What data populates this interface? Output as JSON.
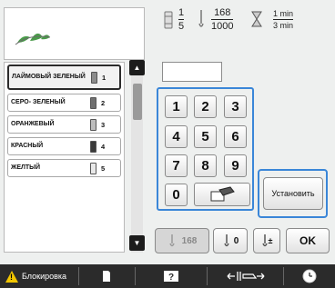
{
  "stats": {
    "color_current": "1",
    "color_total": "5",
    "stitch_current": "168",
    "stitch_total": "1000",
    "time_elapsed": "1 min",
    "time_total": "3 min"
  },
  "threads": [
    {
      "name": "ЛАЙМОВЫЙ ЗЕЛЕНЫЙ",
      "number": "1",
      "color": "#8c8c8c",
      "selected": true
    },
    {
      "name": "СЕРО- ЗЕЛЕНЫЙ",
      "number": "2",
      "color": "#6f6f6f",
      "selected": false
    },
    {
      "name": "ОРАНЖЕВЫЙ",
      "number": "3",
      "color": "#bdbdbd",
      "selected": false
    },
    {
      "name": "КРАСНЫЙ",
      "number": "4",
      "color": "#3a3a3a",
      "selected": false
    },
    {
      "name": "ЖЕЛТЫЙ",
      "number": "5",
      "color": "#e8e8e8",
      "selected": false
    }
  ],
  "scroll": {
    "up_icon": "triangle-up-icon",
    "down_icon": "triangle-down-icon"
  },
  "keypad": {
    "value": "",
    "keys": [
      "1",
      "2",
      "3",
      "4",
      "5",
      "6",
      "7",
      "8",
      "9",
      "0"
    ],
    "clear_icon": "eraser-icon"
  },
  "set_button": "Установить",
  "controls": {
    "stitch_value": "168",
    "step_value": "0",
    "plus_minus": "±",
    "ok": "OK"
  },
  "statusbar": {
    "lock_label": "Блокировка",
    "icons": [
      "page-icon",
      "help-icon",
      "presser-foot-icon",
      "clock-icon"
    ]
  },
  "colors": {
    "accent": "#3a86d8",
    "statusbar": "#2b2b2b",
    "warn": "#f2c600"
  }
}
